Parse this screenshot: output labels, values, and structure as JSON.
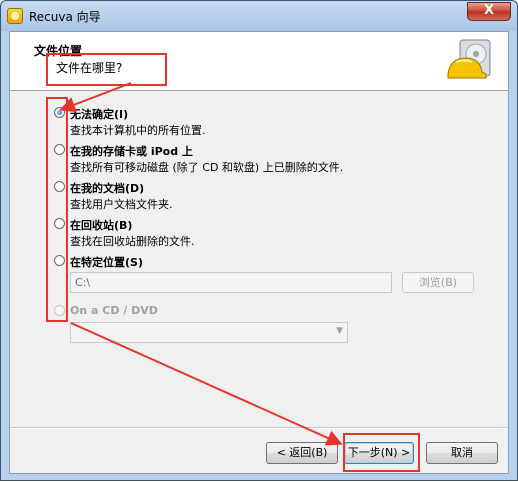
{
  "window": {
    "title": "Recuva 向导",
    "close_label": "X"
  },
  "header": {
    "title": "文件位置",
    "subtitle": "文件在哪里?"
  },
  "options": [
    {
      "label": "无法确定(I)",
      "desc": "查找本计算机中的所有位置.",
      "checked": true,
      "disabled": false
    },
    {
      "label": "在我的存储卡或 iPod 上",
      "desc": "查找所有可移动磁盘 (除了 CD 和软盘) 上已删除的文件.",
      "checked": false,
      "disabled": false
    },
    {
      "label": "在我的文档(D)",
      "desc": "查找用户文档文件夹.",
      "checked": false,
      "disabled": false
    },
    {
      "label": "在回收站(B)",
      "desc": "查找在回收站删除的文件.",
      "checked": false,
      "disabled": false
    },
    {
      "label": "在特定位置(S)",
      "desc": "",
      "checked": false,
      "disabled": false
    },
    {
      "label": "On a CD / DVD",
      "desc": "",
      "checked": false,
      "disabled": true
    }
  ],
  "path_input": {
    "value": "C:\\"
  },
  "browse_label": "浏览(B)",
  "cd_select": {
    "value": ""
  },
  "buttons": {
    "back": "< 返回(B)",
    "next": "下一步(N) >",
    "cancel": "取消"
  },
  "annotation_color": "#e8352b"
}
